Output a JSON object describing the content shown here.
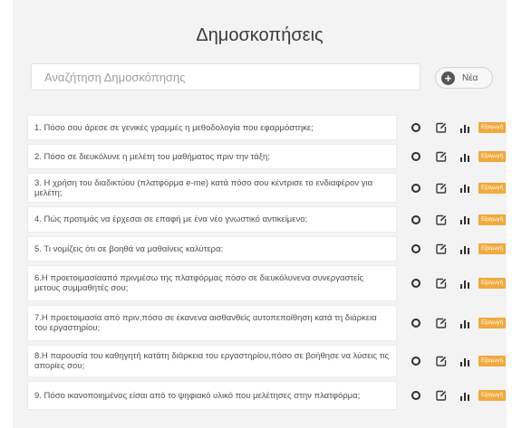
{
  "page": {
    "title": "Δημοσκοπήσεις"
  },
  "search": {
    "placeholder": "Αναζήτηση Δημοσκόπησης"
  },
  "new_button": {
    "label": "Νέα",
    "icon": "plus-circle-icon"
  },
  "badge_color": "#f0a93c",
  "polls": [
    {
      "text": "1. Πόσο σου άρεσε σε γενικές γραμμές η μεθοδολογία που εφαρμόστηκε;",
      "badge": "Εξαγωγή"
    },
    {
      "text": "2. Πόσο σε διευκόλυνε η μελέτη του μαθήματος πριν την τάξη;",
      "badge": "Εξαγωγή"
    },
    {
      "text": "3. Η χρήση του διαδικτύου (πλατφόρμα e-me) κατά πόσο σου κέντρισε το ενδιαφέρον για μελέτη;",
      "badge": "Εξαγωγή"
    },
    {
      "text": "4. Πώς προτιμάς να έρχεσαι σε επαφή με ένα νέο γνωστικό αντικείμενο;",
      "badge": "Εξαγωγή"
    },
    {
      "text": "5. Τι νομίζεις ότι σε βοηθά να μαθαίνεις καλύτερα:",
      "badge": "Εξαγωγή"
    },
    {
      "text": "6.Η προετοιμασίααπό πρινμέσω της πλατφόρμας πόσο σε διευκόλυνενα συνεργαστείς μετους συμμαθητές σου;",
      "badge": "Εξαγωγή"
    },
    {
      "text": "7.Η προετοιμασία από πριν,πόσο σε έκανενα αισθανθείς αυτοπεποίθηση κατά τη διάρκεια του εργαστηρίου;",
      "badge": "Εξαγωγή"
    },
    {
      "text": "8.Η παρουσία του καθηγητή κατάτη διάρκεια του εργαστηρίου,πόσο σε βοήθησε να λύσεις τις απορίες σου;",
      "badge": "Εξαγωγή"
    },
    {
      "text": "9. Πόσο ικανοποιημένος είσαι από το ψηφιακό υλικό που μελέτησες στην πλατφόρμα;",
      "badge": "Εξαγωγή"
    }
  ]
}
